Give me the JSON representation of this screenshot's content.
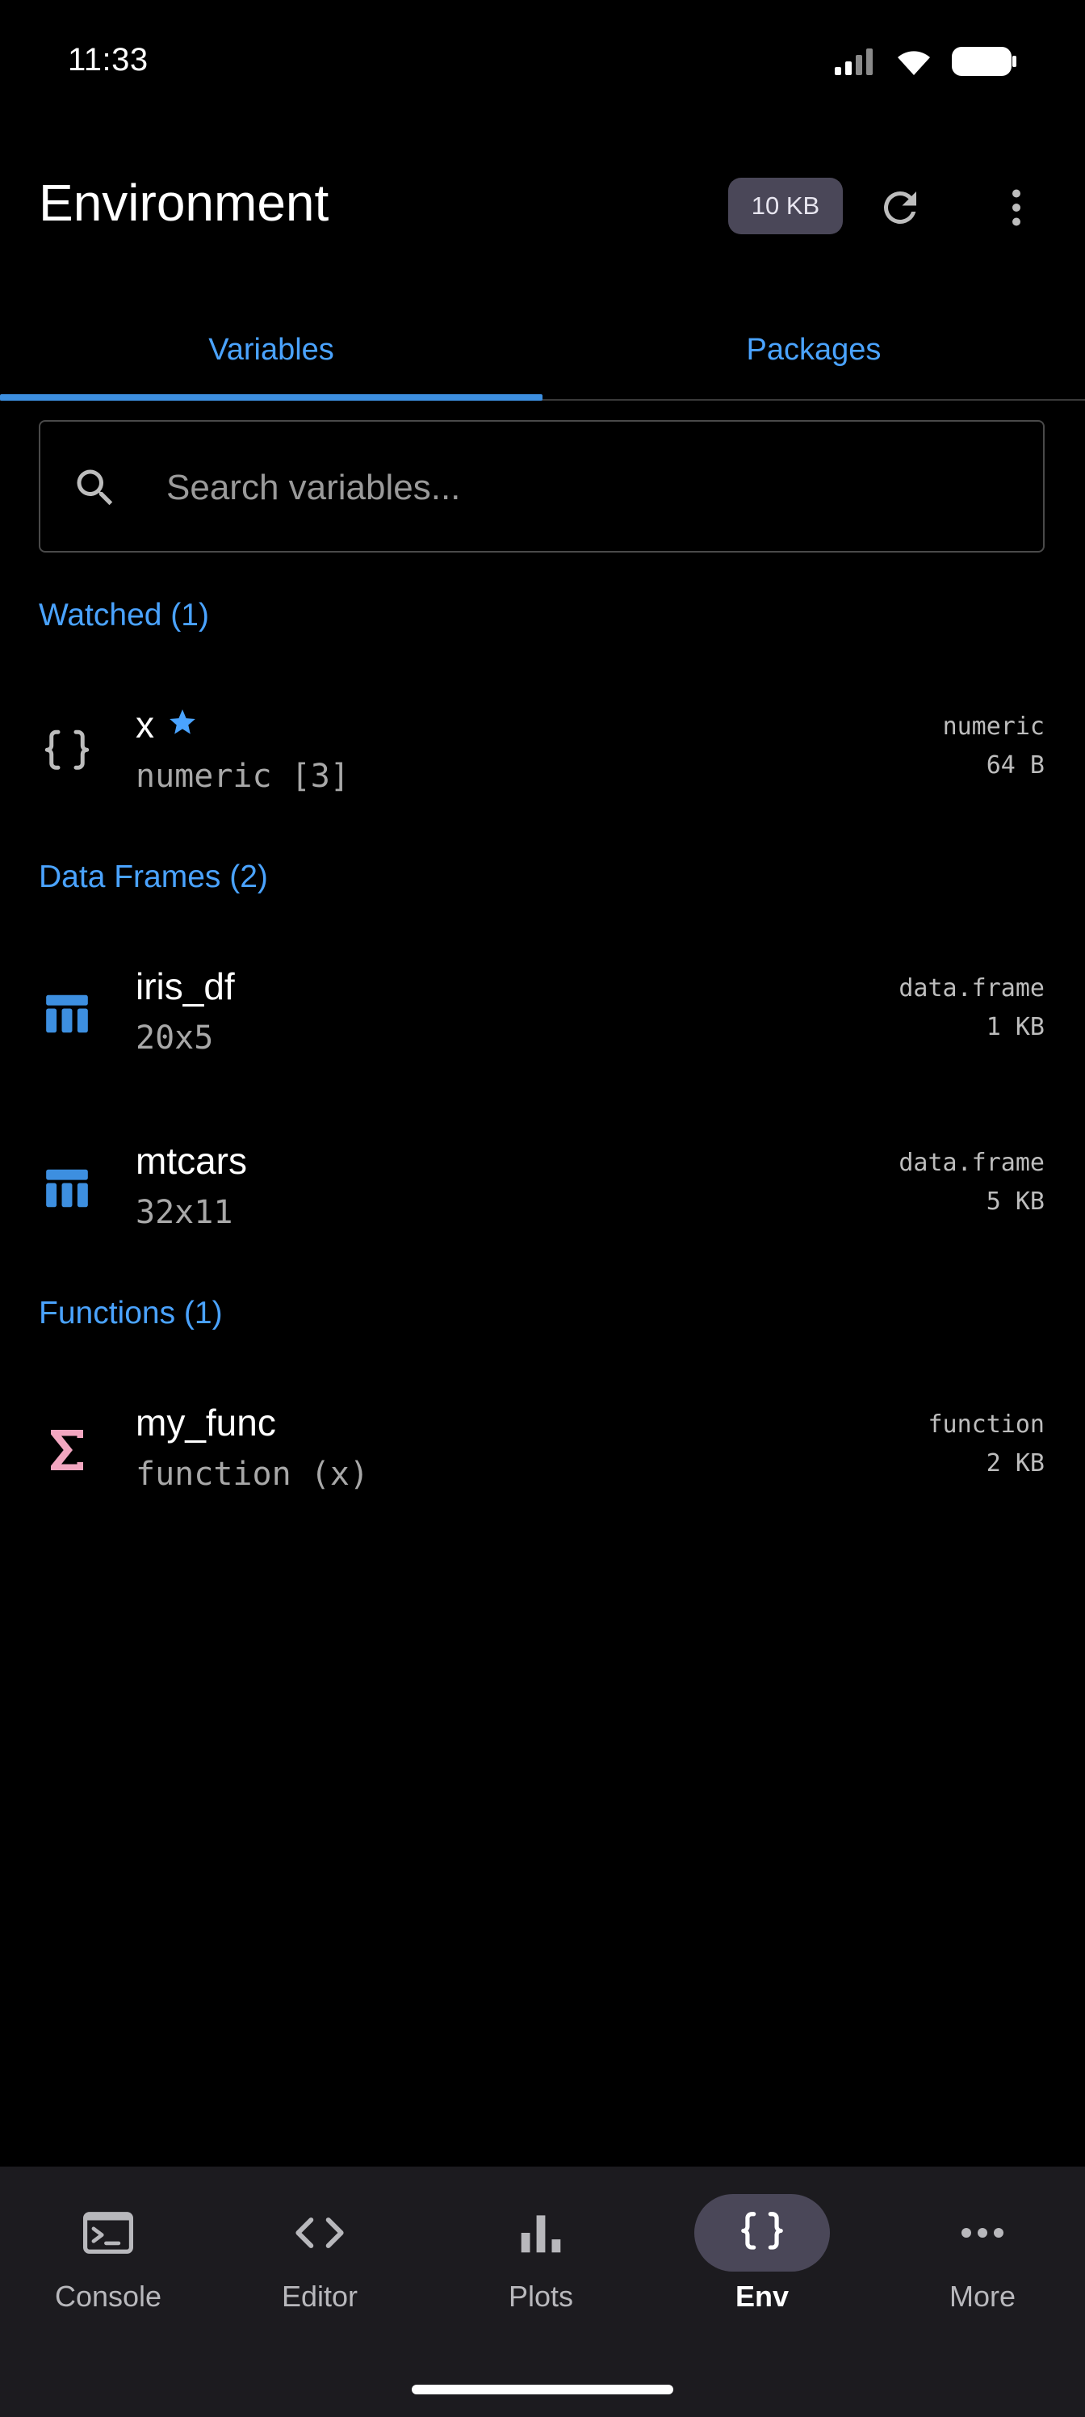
{
  "status_bar": {
    "time": "11:33"
  },
  "app_bar": {
    "title": "Environment",
    "memory_badge": "10 KB"
  },
  "tabs": [
    {
      "label": "Variables",
      "active": true
    },
    {
      "label": "Packages",
      "active": false
    }
  ],
  "search": {
    "placeholder": "Search variables...",
    "value": ""
  },
  "sections": {
    "watched": {
      "title": "Watched (1)",
      "items": [
        {
          "name": "x",
          "detail": "numeric [3]",
          "type": "numeric",
          "size": "64 B",
          "watched": true,
          "icon": "braces-icon"
        }
      ]
    },
    "data_frames": {
      "title": "Data Frames (2)",
      "items": [
        {
          "name": "iris_df",
          "detail": "20x5",
          "type": "data.frame",
          "size": "1 KB",
          "icon": "table-icon"
        },
        {
          "name": "mtcars",
          "detail": "32x11",
          "type": "data.frame",
          "size": "5 KB",
          "icon": "table-icon"
        }
      ]
    },
    "functions": {
      "title": "Functions (1)",
      "items": [
        {
          "name": "my_func",
          "detail": "function (x)",
          "type": "function",
          "size": "2 KB",
          "icon": "sigma-icon"
        }
      ]
    }
  },
  "bottom_nav": [
    {
      "label": "Console",
      "icon": "terminal-icon",
      "active": false
    },
    {
      "label": "Editor",
      "icon": "code-icon",
      "active": false
    },
    {
      "label": "Plots",
      "icon": "bar-chart-icon",
      "active": false
    },
    {
      "label": "Env",
      "icon": "braces-icon",
      "active": true
    },
    {
      "label": "More",
      "icon": "more-horizontal-icon",
      "active": false
    }
  ],
  "colors": {
    "accent": "#4aa3ff",
    "indicator": "#3d8fe0",
    "table_icon": "#3d8fe0",
    "function_icon": "#f2a6c0",
    "badge_bg": "#4a4758",
    "nav_bg": "#1c1b1f"
  }
}
